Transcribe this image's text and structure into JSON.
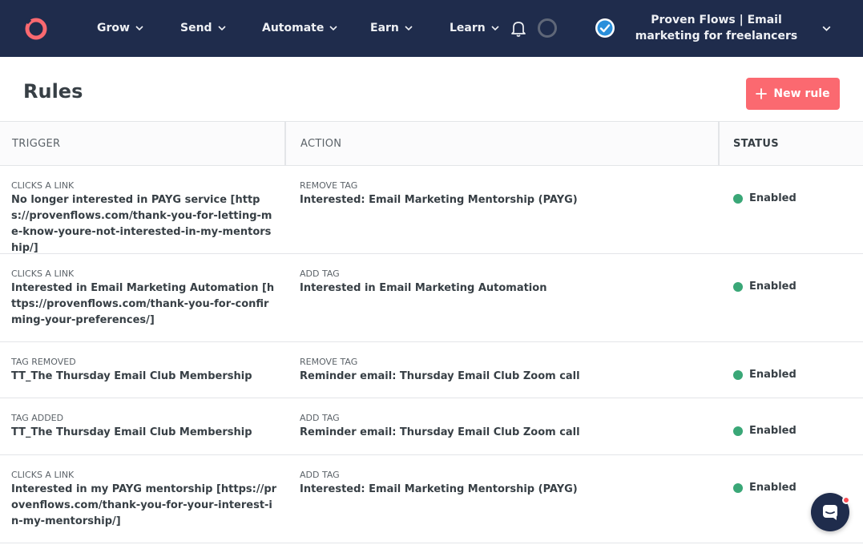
{
  "nav": {
    "items": [
      {
        "label": "Grow"
      },
      {
        "label": "Send"
      },
      {
        "label": "Automate"
      },
      {
        "label": "Earn"
      },
      {
        "label": "Learn"
      }
    ],
    "account": {
      "name": "Proven Flows | Email marketing for freelancers"
    }
  },
  "page": {
    "title": "Rules",
    "new_rule_label": "New rule"
  },
  "table": {
    "headers": {
      "trigger": "TRIGGER",
      "action": "ACTION",
      "status": "STATUS"
    },
    "rows": [
      {
        "trigger_type": "CLICKS A LINK",
        "trigger_value": "No longer interested in PAYG service [https://provenflows.com/thank-you-for-letting-me-know-youre-not-interested-in-my-mentorship/]",
        "action_type": "REMOVE TAG",
        "action_value": "Interested: Email Marketing Mentorship (PAYG)",
        "status": "Enabled"
      },
      {
        "trigger_type": "CLICKS A LINK",
        "trigger_value": "Interested in Email Marketing Automation [https://provenflows.com/thank-you-for-confirming-your-preferences/]",
        "action_type": "ADD TAG",
        "action_value": "Interested in Email Marketing Automation",
        "status": "Enabled"
      },
      {
        "trigger_type": "TAG REMOVED",
        "trigger_value": "TT_The Thursday Email Club Membership",
        "action_type": "REMOVE TAG",
        "action_value": "Reminder email: Thursday Email Club Zoom call",
        "status": "Enabled"
      },
      {
        "trigger_type": "TAG ADDED",
        "trigger_value": "TT_The Thursday Email Club Membership",
        "action_type": "ADD TAG",
        "action_value": "Reminder email: Thursday Email Club Zoom call",
        "status": "Enabled"
      },
      {
        "trigger_type": "CLICKS A LINK",
        "trigger_value": "Interested in my PAYG mentorship [https://provenflows.com/thank-you-for-your-interest-in-my-mentorship/]",
        "action_type": "ADD TAG",
        "action_value": "Interested: Email Marketing Mentorship (PAYG)",
        "status": "Enabled"
      }
    ]
  },
  "colors": {
    "nav_bg": "#1f2c4c",
    "accent": "#fb6970",
    "enabled": "#3aa777"
  }
}
